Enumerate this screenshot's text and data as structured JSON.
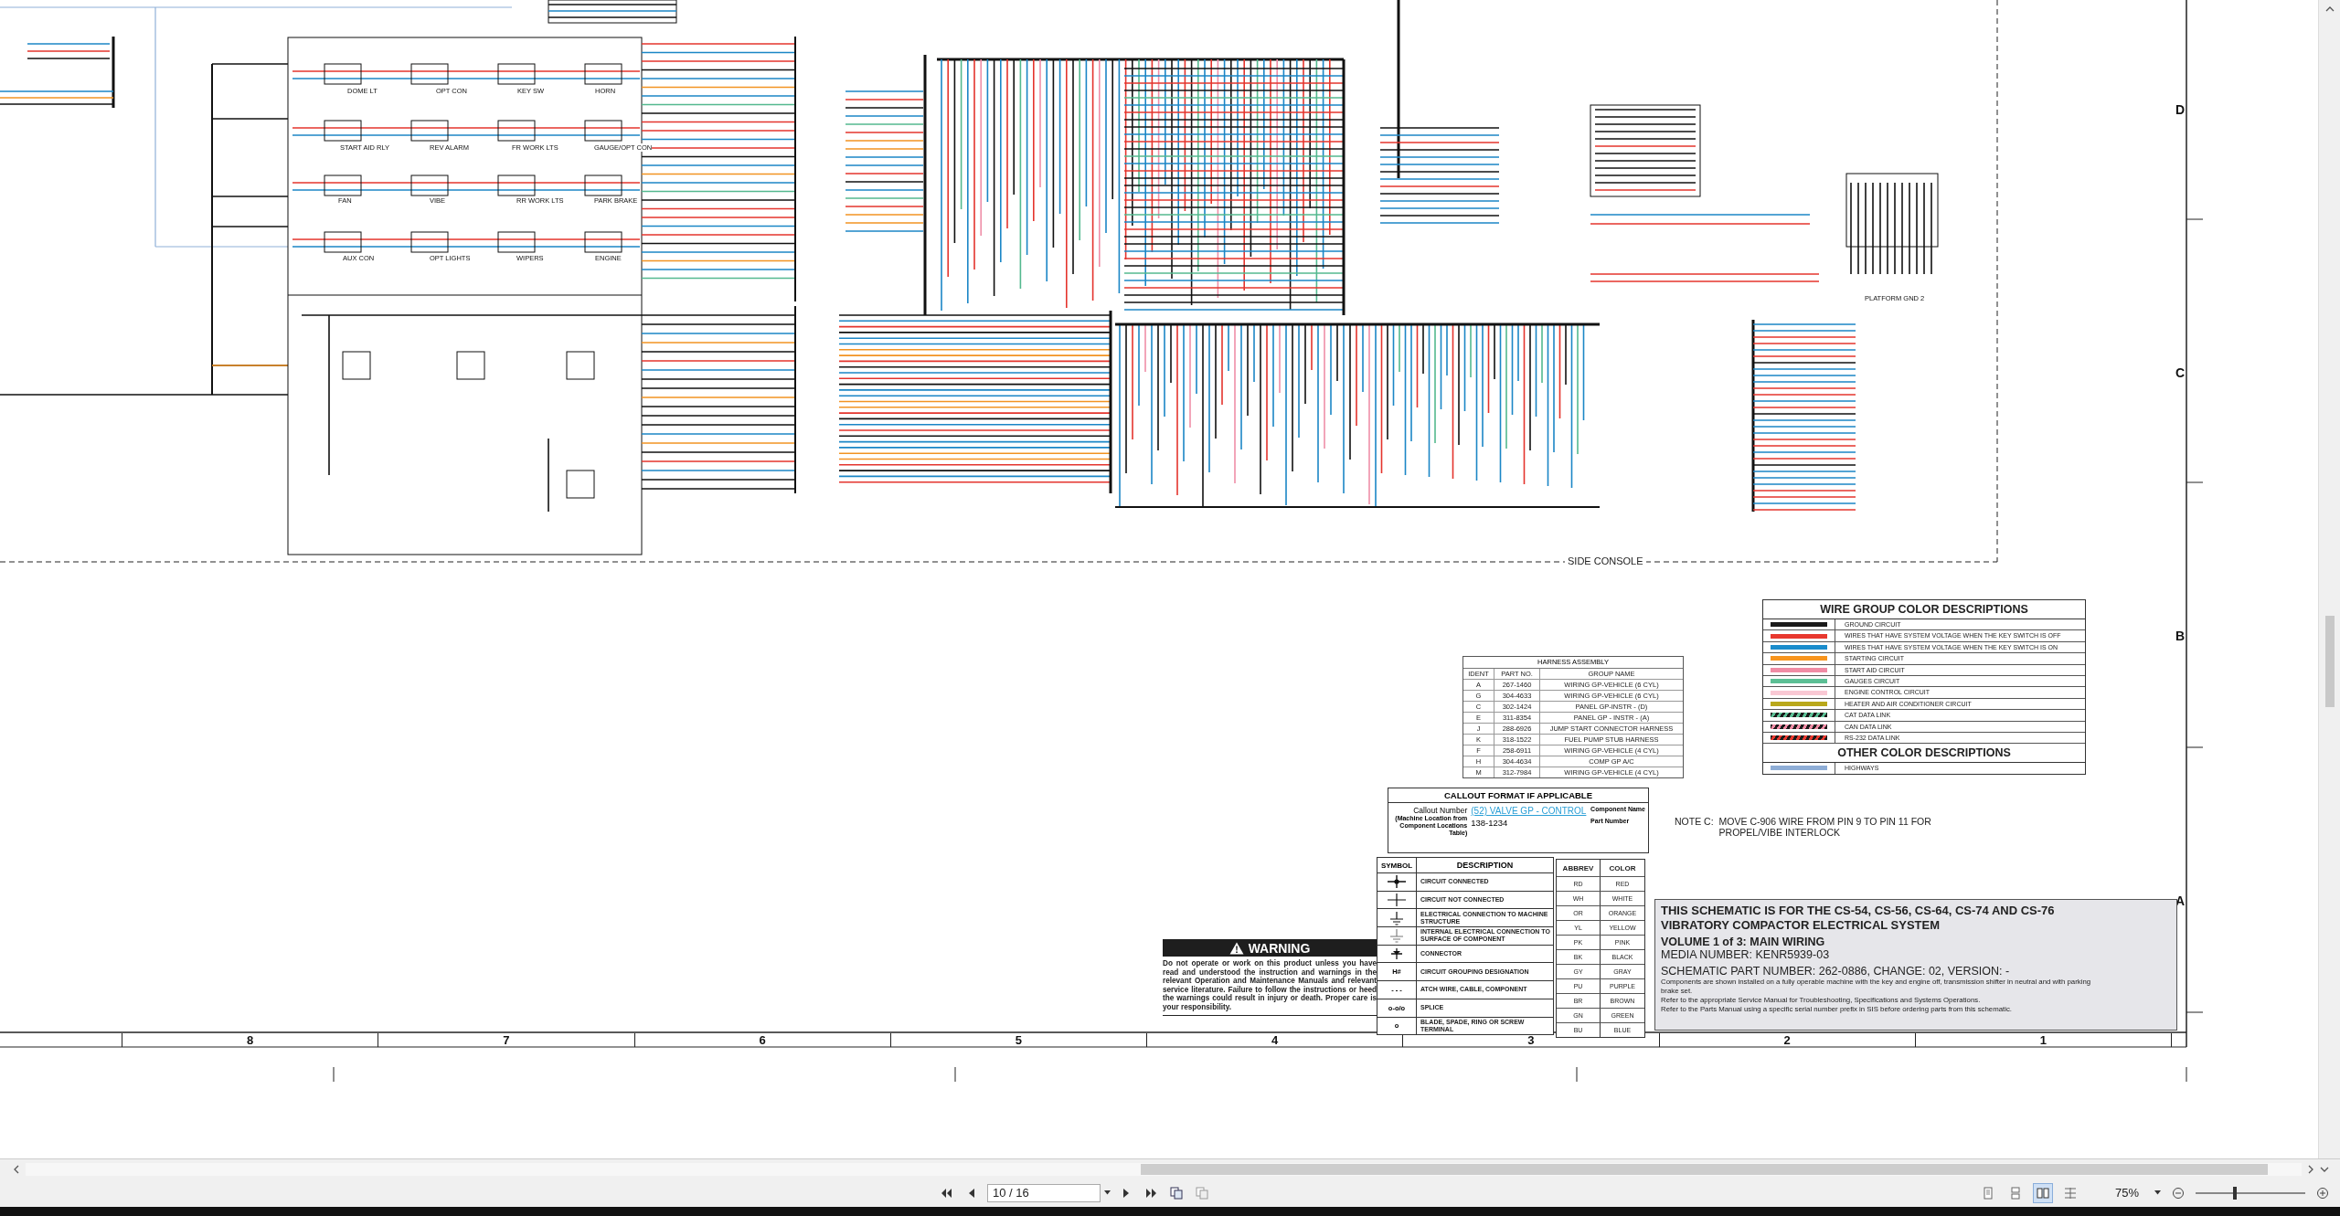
{
  "sheet": {
    "zone_letters": [
      "D",
      "C",
      "B",
      "A"
    ],
    "zone_numbers": [
      "8",
      "7",
      "6",
      "5",
      "4",
      "3",
      "2",
      "1"
    ],
    "section_label": "SIDE CONSOLE",
    "components": [
      {
        "name": "DOME LT"
      },
      {
        "name": "OPT CON"
      },
      {
        "name": "KEY SW"
      },
      {
        "name": "HORN"
      },
      {
        "name": "START AID RLY"
      },
      {
        "name": "REV ALARM"
      },
      {
        "name": "FR WORK LTS"
      },
      {
        "name": "GAUGE/OPT CON"
      },
      {
        "name": "FAN"
      },
      {
        "name": "VIBE"
      },
      {
        "name": "RR WORK LTS"
      },
      {
        "name": "PARK BRAKE"
      },
      {
        "name": "AUX CON"
      },
      {
        "name": "OPT LIGHTS"
      },
      {
        "name": "WIPERS"
      },
      {
        "name": "ENGINE"
      }
    ],
    "ground_label": "PLATFORM GND 2",
    "note": {
      "label": "NOTE C:",
      "text": "MOVE C-906 WIRE FROM PIN 9 TO PIN 11 FOR PROPEL/VIBE INTERLOCK"
    }
  },
  "wire_legend": {
    "title": "WIRE GROUP COLOR DESCRIPTIONS",
    "groups": [
      {
        "kind": "solid",
        "color": "#1a1a1a",
        "label": "GROUND CIRCUIT"
      },
      {
        "kind": "solid",
        "color": "#e8392f",
        "label": "WIRES THAT HAVE SYSTEM VOLTAGE WHEN THE KEY SWITCH IS OFF"
      },
      {
        "kind": "solid",
        "color": "#1a8ccc",
        "label": "WIRES THAT HAVE SYSTEM VOLTAGE WHEN THE KEY SWITCH IS ON"
      },
      {
        "kind": "solid",
        "color": "#f7941d",
        "label": "STARTING CIRCUIT"
      },
      {
        "kind": "solid",
        "color": "#f08ca5",
        "label": "START AID CIRCUIT"
      },
      {
        "kind": "solid",
        "color": "#5cbf95",
        "label": "GAUGES CIRCUIT"
      },
      {
        "kind": "solid",
        "color": "#f9c8d4",
        "label": "ENGINE CONTROL CIRCUIT"
      },
      {
        "kind": "solid",
        "color": "#b9a81b",
        "label": "HEATER AND AIR CONDITIONER CIRCUIT"
      },
      {
        "kind": "striped",
        "color": "#5cbf95",
        "label": "CAT DATA LINK"
      },
      {
        "kind": "striped",
        "color": "#f08ca5",
        "label": "CAN DATA LINK"
      },
      {
        "kind": "striped",
        "color": "#e8392f",
        "label": "RS-232 DATA LINK"
      }
    ],
    "other_title": "OTHER COLOR DESCRIPTIONS",
    "other": [
      {
        "kind": "solid",
        "color": "#8eadd6",
        "label": "HIGHWAYS"
      }
    ]
  },
  "harness_table": {
    "title": "HARNESS ASSEMBLY",
    "columns": [
      "IDENT",
      "PART NO.",
      "GROUP NAME"
    ],
    "rows": [
      [
        "A",
        "267-1460",
        "WIRING GP-VEHICLE (6 CYL)"
      ],
      [
        "G",
        "304-4633",
        "WIRING GP-VEHICLE (6 CYL)"
      ],
      [
        "C",
        "302-1424",
        "PANEL GP-INSTR - (D)"
      ],
      [
        "E",
        "311-8354",
        "PANEL GP - INSTR - (A)"
      ],
      [
        "J",
        "288-6926",
        "JUMP START CONNECTOR HARNESS"
      ],
      [
        "K",
        "318-1522",
        "FUEL PUMP STUB HARNESS"
      ],
      [
        "F",
        "258-6911",
        "WIRING GP-VEHICLE (4 CYL)"
      ],
      [
        "H",
        "304-4634",
        "COMP GP A/C"
      ],
      [
        "M",
        "312-7984",
        "WIRING GP-VEHICLE (4 CYL)"
      ]
    ]
  },
  "callout": {
    "title": "CALLOUT FORMAT IF APPLICABLE",
    "number_label": "Callout Number",
    "number_hint": "(Machine Location from Component Locations Table)",
    "component": "(52) VALVE GP - CONTROL",
    "component_label": "Component Name",
    "part": "138-1234",
    "part_label": "Part Number"
  },
  "symbols": {
    "columns": [
      "SYMBOL",
      "DESCRIPTION"
    ],
    "rows": [
      {
        "kind": "connected",
        "description": "CIRCUIT CONNECTED"
      },
      {
        "kind": "not_connected",
        "description": "CIRCUIT NOT CONNECTED"
      },
      {
        "kind": "ground",
        "description": "ELECTRICAL CONNECTION TO MACHINE STRUCTURE"
      },
      {
        "kind": "internal_ground",
        "description": "INTERNAL ELECTRICAL CONNECTION TO SURFACE OF COMPONENT"
      },
      {
        "kind": "connector",
        "description": "CONNECTOR"
      },
      {
        "kind": "text",
        "symbol": "H#",
        "description": "CIRCUIT GROUPING DESIGNATION"
      },
      {
        "kind": "text",
        "symbol": "- - -",
        "description": "ATCH WIRE, CABLE, COMPONENT"
      },
      {
        "kind": "text",
        "symbol": "o-o/o",
        "description": "SPLICE"
      },
      {
        "kind": "text",
        "symbol": "o",
        "description": "BLADE, SPADE, RING OR SCREW TERMINAL"
      }
    ]
  },
  "abbreviations": {
    "columns": [
      "ABBREV",
      "COLOR"
    ],
    "rows": [
      [
        "RD",
        "RED"
      ],
      [
        "WH",
        "WHITE"
      ],
      [
        "OR",
        "ORANGE"
      ],
      [
        "YL",
        "YELLOW"
      ],
      [
        "PK",
        "PINK"
      ],
      [
        "BK",
        "BLACK"
      ],
      [
        "GY",
        "GRAY"
      ],
      [
        "PU",
        "PURPLE"
      ],
      [
        "BR",
        "BROWN"
      ],
      [
        "GN",
        "GREEN"
      ],
      [
        "BU",
        "BLUE"
      ]
    ]
  },
  "warning": {
    "title": "WARNING",
    "text": "Do not operate or work on this product unless you have read and understood the instruction and warnings in the relevant Operation and Maintenance Manuals and relevant service literature. Failure to follow the instructions or heed the warnings could result in injury or death. Proper care is your responsibility."
  },
  "title_block": {
    "heading": "THIS SCHEMATIC IS FOR THE CS-54, CS-56, CS-64, CS-74 AND CS-76 VIBRATORY COMPACTOR ELECTRICAL SYSTEM",
    "volume": "VOLUME 1 of 3: MAIN WIRING",
    "media": "MEDIA NUMBER: KENR5939-03",
    "part_number": "SCHEMATIC PART NUMBER: 262-0886, CHANGE: 02, VERSION: -",
    "notes": [
      "Components are shown installed on a fully operable machine with the key and engine off, transmission shifter in neutral and with parking brake set.",
      "Refer to the appropriate Service Manual for Troubleshooting, Specifications and Systems Operations.",
      "Refer to the Parts Manual using a specific serial number prefix in SIS before ordering parts from this schematic."
    ]
  },
  "viewer": {
    "page": "10 / 16",
    "zoom": "75%",
    "zoom_slider": {
      "level": 0.36
    }
  }
}
